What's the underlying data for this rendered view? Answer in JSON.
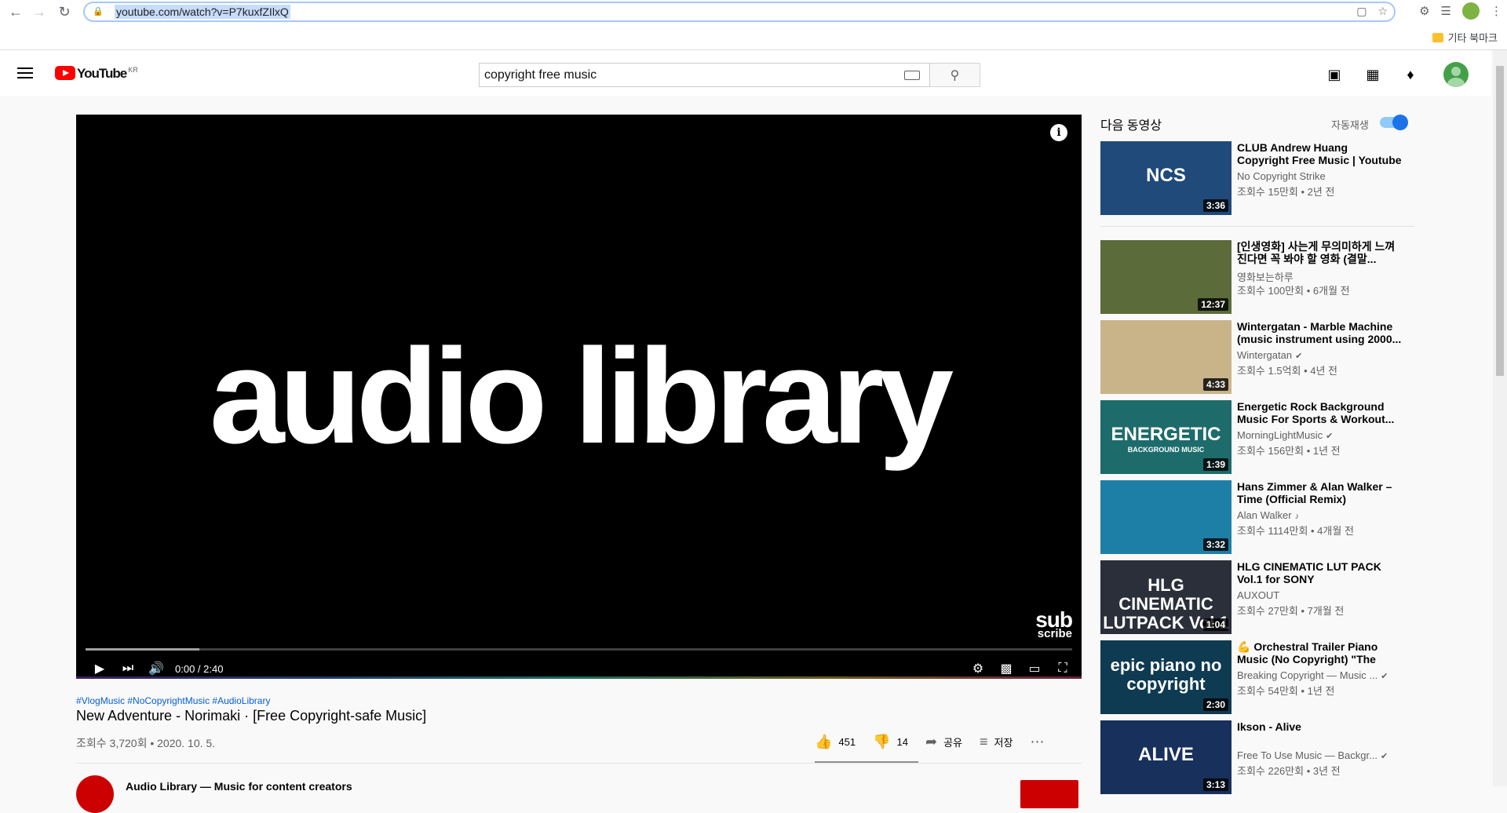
{
  "browser": {
    "url": "youtube.com/watch?v=P7kuxfZIlxQ",
    "bookmark_folder": "기타 북마크"
  },
  "header": {
    "logo_text": "YouTube",
    "logo_region": "KR",
    "search_query": "copyright free music"
  },
  "player": {
    "overlay_text": "audio library",
    "watermark_line1": "sub",
    "watermark_line2": "scribe",
    "time": "0:00 / 2:40"
  },
  "video": {
    "hashtags": "#VlogMusic #NoCopyrightMusic #AudioLibrary",
    "title": "New Adventure - Norimaki · [Free Copyright-safe Music]",
    "views_date": "조회수 3,720회 • 2020. 10. 5.",
    "likes": "451",
    "dislikes": "14",
    "share_label": "공유",
    "save_label": "저장",
    "channel_name": "Audio Library — Music for content creators"
  },
  "sidebar": {
    "up_next_label": "다음 동영상",
    "autoplay_label": "자동재생",
    "autoplay_on": true,
    "items": [
      {
        "title": "CLUB Andrew Huang Copyright Free Music | Youtube Audio...",
        "channel": "No Copyright Strike",
        "meta": "조회수 15만회 • 2년 전",
        "duration": "3:36",
        "thumb_text": "NCS",
        "thumb_color": "#1f4a7a",
        "verified": false
      },
      {
        "title": "[인생영화] 사는게 무의미하게 느껴진다면 꼭 봐야 할 영화 (결말...",
        "channel": "영화보는하루",
        "meta": "조회수 100만회 • 6개월 전",
        "duration": "12:37",
        "thumb_text": "",
        "thumb_color": "#5b6b3a",
        "verified": false
      },
      {
        "title": "Wintergatan - Marble Machine (music instrument using 2000...",
        "channel": "Wintergatan",
        "meta": "조회수 1.5억회 • 4년 전",
        "duration": "4:33",
        "thumb_text": "",
        "thumb_color": "#c9b48a",
        "verified": true
      },
      {
        "title": "Energetic Rock Background Music For Sports & Workout...",
        "channel": "MorningLightMusic",
        "meta": "조회수 156만회 • 1년 전",
        "duration": "1:39",
        "thumb_text": "ENERGETIC",
        "thumb_sub": "BACKGROUND MUSIC",
        "thumb_color": "#1d6b6b",
        "verified": true
      },
      {
        "title": "Hans Zimmer & Alan Walker – Time (Official Remix)",
        "channel": "Alan Walker",
        "meta": "조회수 1114만회 • 4개월 전",
        "duration": "3:32",
        "thumb_text": "",
        "thumb_color": "#1e7fa6",
        "verified": false,
        "music_note": true
      },
      {
        "title": "HLG CINEMATIC LUT PACK Vol.1 for SONY",
        "channel": "AUXOUT",
        "meta": "조회수 27만회 • 7개월 전",
        "duration": "1:04",
        "thumb_text": "HLG CINEMATIC LUTPACK Vol.1",
        "thumb_color": "#2b2f3a",
        "verified": false
      },
      {
        "title": "💪 Orchestral Trailer Piano Music (No Copyright) \"The Epi...",
        "channel": "Breaking Copyright — Music ...",
        "meta": "조회수 54만회 • 1년 전",
        "duration": "2:30",
        "thumb_text": "epic piano no copyright",
        "thumb_color": "#0e3a52",
        "verified": true
      },
      {
        "title": "Ikson - Alive",
        "channel": "Free To Use Music — Backgr...",
        "meta": "조회수 226만회 • 3년 전",
        "duration": "3:13",
        "thumb_text": "ALIVE",
        "thumb_color": "#17305c",
        "verified": true
      }
    ]
  }
}
